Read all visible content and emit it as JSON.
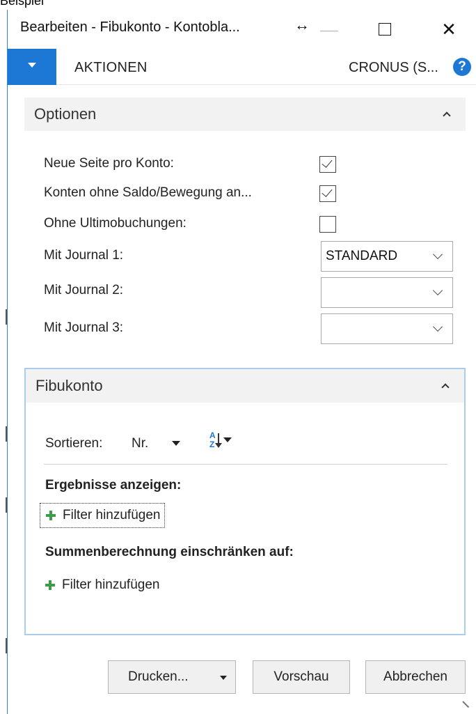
{
  "background_fragment": "Beispiel",
  "window": {
    "title": "Bearbeiten - Fibukonto - Kontobla...",
    "resize_glyph": "↔",
    "minimize_glyph": "—",
    "close_glyph": "✕"
  },
  "ribbon": {
    "actions_label": "AKTIONEN",
    "company_label": "CRONUS (S...",
    "help_glyph": "?"
  },
  "options": {
    "title": "Optionen",
    "fields": [
      {
        "label": "Neue Seite pro Konto:",
        "type": "checkbox",
        "checked": true
      },
      {
        "label": "Konten ohne Saldo/Bewegung an...",
        "type": "checkbox",
        "checked": true
      },
      {
        "label": "Ohne Ultimobuchungen:",
        "type": "checkbox",
        "checked": false
      },
      {
        "label": "Mit Journal 1:",
        "type": "select",
        "value": "STANDARD"
      },
      {
        "label": "Mit Journal 2:",
        "type": "select",
        "value": ""
      },
      {
        "label": "Mit Journal 3:",
        "type": "select",
        "value": ""
      }
    ]
  },
  "fibukonto": {
    "title": "Fibukonto",
    "sort_label": "Sortieren:",
    "sort_value": "Nr.",
    "sort_order_icon": "sort-ascending-icon",
    "results_label": "Ergebnisse anzeigen:",
    "add_filter_label": "Filter hinzufügen",
    "totals_label": "Summenberechnung einschränken auf:",
    "add_filter_label_2": "Filter hinzufügen"
  },
  "footer": {
    "print_label": "Drucken...",
    "preview_label": "Vorschau",
    "cancel_label": "Abbrechen"
  },
  "colors": {
    "accent": "#1c78d4",
    "fasttab_border": "#a9ccef",
    "plus_green": "#3d9c4a"
  }
}
